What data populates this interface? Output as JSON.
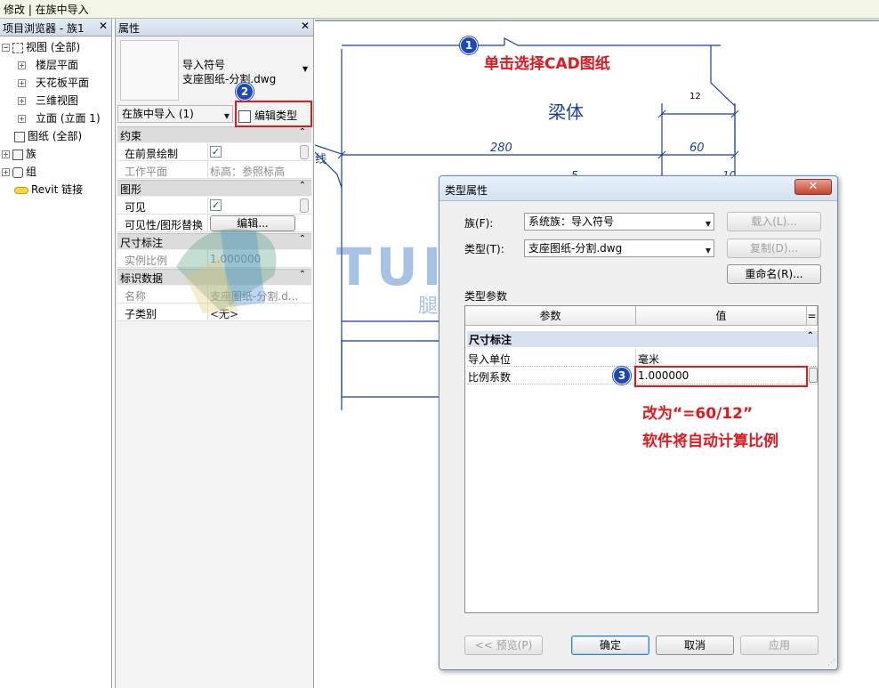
{
  "window": {
    "title": "修改 | 在族中导入"
  },
  "browser": {
    "title": "项目浏览器 - 族1",
    "close": "✕",
    "items": [
      {
        "label": "视图 (全部)",
        "expander": "⊟"
      },
      {
        "label": "楼层平面",
        "expander": "⊞"
      },
      {
        "label": "天花板平面",
        "expander": "⊞"
      },
      {
        "label": "三维视图",
        "expander": "⊞"
      },
      {
        "label": "立面 (立面 1)",
        "expander": "⊞"
      },
      {
        "label": "图纸 (全部)",
        "expander": ""
      },
      {
        "label": "族",
        "expander": "⊞"
      },
      {
        "label": "组",
        "expander": "⊞"
      },
      {
        "label": "Revit 链接",
        "expander": ""
      }
    ]
  },
  "props": {
    "title": "属性",
    "close": "✕",
    "type_line1": "导入符号",
    "type_line2": "支座图纸-分割.dwg",
    "instance_selector": "在族中导入 (1)",
    "edit_type": "编辑类型",
    "sections": {
      "constraints": "约束",
      "graphics": "图形",
      "dimensions": "尺寸标注",
      "identity": "标识数据"
    },
    "rows": {
      "draw_foreground": {
        "key": "在前景绘制",
        "checked": "✓"
      },
      "work_plane": {
        "key": "工作平面",
        "value": "标高：参照标高"
      },
      "visible": {
        "key": "可见",
        "checked": "✓"
      },
      "vis_override": {
        "key": "可见性/图形替换",
        "button": "编辑..."
      },
      "instance_scale": {
        "key": "实例比例",
        "value": "1.000000"
      },
      "name": {
        "key": "名称",
        "value": "支座图纸-分割.d..."
      },
      "subcategory": {
        "key": "子类别",
        "value": "<无>"
      }
    }
  },
  "drawing": {
    "label_beam": "梁体",
    "dim_12": "12",
    "dim_280": "280",
    "dim_60": "60",
    "dim_5": "5",
    "dim_10": "10",
    "side_text": "线"
  },
  "dialog": {
    "title": "类型属性",
    "close": "✕",
    "family_label": "族(F):",
    "family_value": "系统族：导入符号",
    "type_label": "类型(T):",
    "type_value": "支座图纸-分割.dwg",
    "load_btn": "载入(L)...",
    "duplicate_btn": "复制(D)...",
    "rename_btn": "重命名(R)...",
    "type_params_label": "类型参数",
    "col_param": "参数",
    "col_value": "值",
    "col_eq": "=",
    "section_dim": "尺寸标注",
    "row_units": {
      "key": "导入单位",
      "value": "毫米"
    },
    "row_scale": {
      "key": "比例系数",
      "value": "1.000000"
    },
    "preview_btn": "<< 预览(P)",
    "ok_btn": "确定",
    "cancel_btn": "取消",
    "apply_btn": "应用"
  },
  "annotations": {
    "step1_num": "1",
    "step1_text": "单击选择CAD图纸",
    "step2_num": "2",
    "step3_num": "3",
    "step3_text_line1": "改为“=60/12”",
    "step3_text_line2": "软件将自动计算比例",
    "accent_red": "#e0191e",
    "accent_blue": "#1d49b8"
  },
  "watermark": {
    "brand": "TUITUISOFT",
    "sub": "腿腿教学网"
  }
}
